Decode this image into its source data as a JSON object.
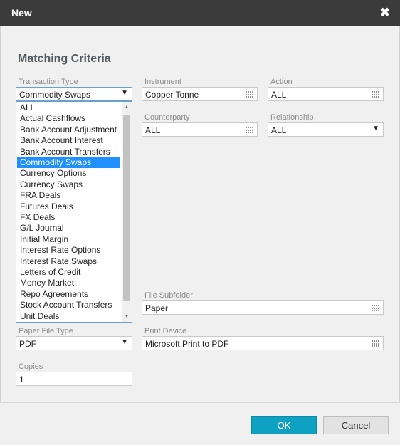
{
  "dialog": {
    "title": "New",
    "close_symbol": "✖"
  },
  "section": {
    "heading": "Matching Criteria"
  },
  "fields": {
    "transaction_type": {
      "label": "Transaction Type",
      "value": "Commodity Swaps"
    },
    "instrument": {
      "label": "Instrument",
      "value": "Copper Tonne"
    },
    "action": {
      "label": "Action",
      "value": "ALL"
    },
    "counterparty": {
      "label": "Counterparty",
      "value": "ALL"
    },
    "relationship": {
      "label": "Relationship",
      "value": "ALL"
    },
    "file_subfolder": {
      "label": "File Subfolder",
      "value": "Paper"
    },
    "paper_file_type": {
      "label": "Paper File Type",
      "value": "PDF"
    },
    "print_device": {
      "label": "Print Device",
      "value": "Microsoft Print to PDF"
    },
    "copies": {
      "label": "Copies",
      "value": "1"
    }
  },
  "dropdown": {
    "caret": "▼",
    "scroll_up": "▲",
    "scroll_down": "▼",
    "selected_index": 5,
    "options": [
      "ALL",
      "Actual Cashflows",
      "Bank Account Adjustment",
      "Bank Account Interest",
      "Bank Account Transfers",
      "Commodity Swaps",
      "Currency Options",
      "Currency Swaps",
      "FRA Deals",
      "Futures Deals",
      "FX Deals",
      "G/L Journal",
      "Initial Margin",
      "Interest Rate Options",
      "Interest Rate Swaps",
      "Letters of Credit",
      "Money Market",
      "Repo Agreements",
      "Stock Account Transfers",
      "Unit Deals"
    ]
  },
  "buttons": {
    "ok": "OK",
    "cancel": "Cancel"
  },
  "colors": {
    "titlebar": "#3b3b3b",
    "accent": "#0ea1c2",
    "selection": "#1e90ff"
  }
}
